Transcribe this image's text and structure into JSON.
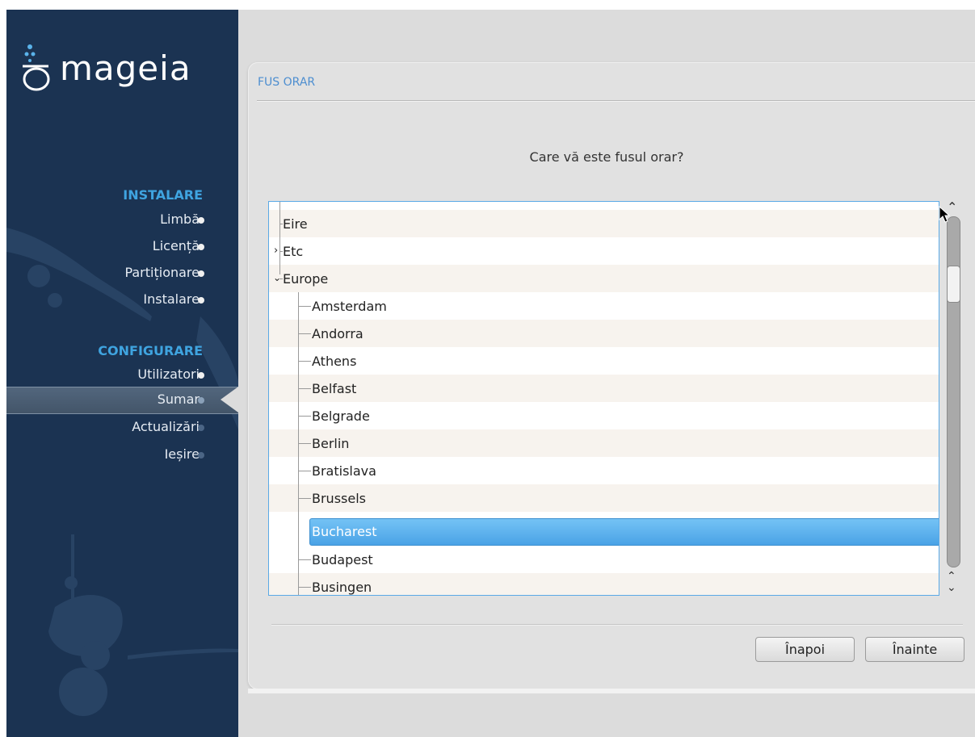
{
  "sidebar": {
    "logo_text": "mageia",
    "sections": [
      {
        "title": "INSTALARE"
      },
      {
        "title": "CONFIGURARE"
      }
    ],
    "steps": [
      {
        "label": "Limbă"
      },
      {
        "label": "Licență"
      },
      {
        "label": "Partiționare"
      },
      {
        "label": "Instalare"
      },
      {
        "label": "Utilizatori"
      },
      {
        "label": "Sumar"
      },
      {
        "label": "Actualizări"
      },
      {
        "label": "Ieșire"
      }
    ],
    "active_step": "Sumar"
  },
  "dialog": {
    "title": "FUS ORAR",
    "question": "Care vă este fusul orar?"
  },
  "tree": {
    "top_items": [
      {
        "label": "Eire"
      },
      {
        "label": "Etc",
        "expander": ">"
      },
      {
        "label": "Europe",
        "expander": "v"
      }
    ],
    "children": [
      {
        "label": "Amsterdam"
      },
      {
        "label": "Andorra"
      },
      {
        "label": "Athens"
      },
      {
        "label": "Belfast"
      },
      {
        "label": "Belgrade"
      },
      {
        "label": "Berlin"
      },
      {
        "label": "Bratislava"
      },
      {
        "label": "Brussels"
      },
      {
        "label": "Bucharest"
      },
      {
        "label": "Budapest"
      },
      {
        "label": "Busingen"
      }
    ],
    "selected": "Bucharest"
  },
  "buttons": {
    "back": "Înapoi",
    "next": "Înainte"
  },
  "colors": {
    "sidebar_bg": "#1b3352",
    "section_title": "#3fa4e0",
    "dialog_title": "#4d8ed0",
    "selection": "#4aa3e6"
  }
}
